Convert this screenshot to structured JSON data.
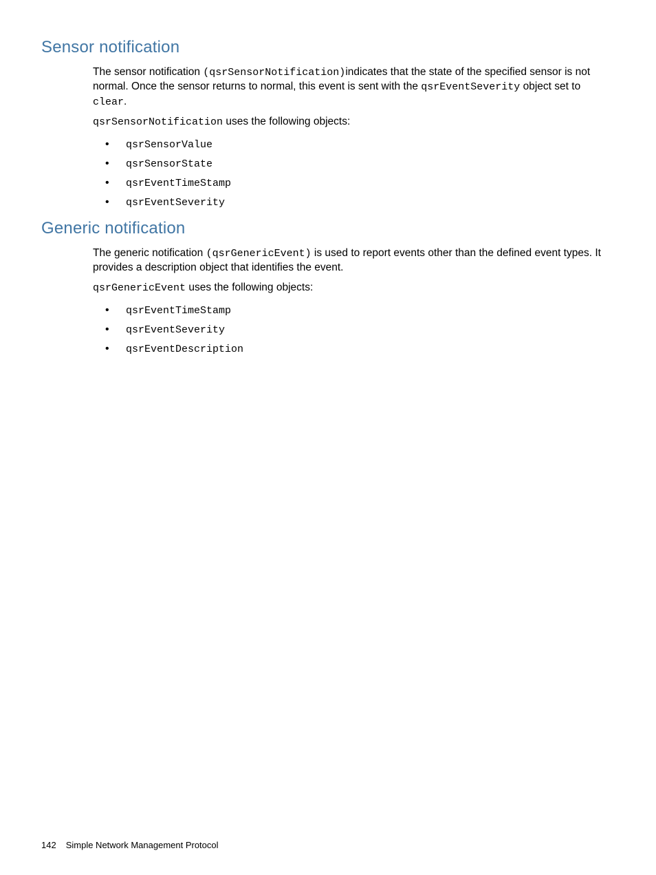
{
  "sections": [
    {
      "heading": "Sensor notification",
      "para1_part1": "The sensor notification ",
      "para1_code1": "(qsrSensorNotification)",
      "para1_part2": "indicates that the state of the specified sensor is not normal. Once the sensor returns to normal, this event is sent with the ",
      "para1_code2": "qsrEventSeverity",
      "para1_part3": " object set to ",
      "para1_code3": "clear",
      "para1_part4": ".",
      "para2_code": "qsrSensorNotification",
      "para2_text": " uses the following objects:",
      "items": [
        "qsrSensorValue",
        "qsrSensorState",
        "qsrEventTimeStamp",
        "qsrEventSeverity"
      ]
    },
    {
      "heading": "Generic notification",
      "para1_part1": "The generic notification ",
      "para1_code1": "(qsrGenericEvent)",
      "para1_part2": " is used to report events other than the defined event types. It provides a description object that identifies the event.",
      "para2_code": "qsrGenericEvent",
      "para2_text": " uses the following objects:",
      "items": [
        "qsrEventTimeStamp",
        "qsrEventSeverity",
        "qsrEventDescription"
      ]
    }
  ],
  "footer": {
    "page_number": "142",
    "chapter_title": "Simple Network Management Protocol"
  }
}
